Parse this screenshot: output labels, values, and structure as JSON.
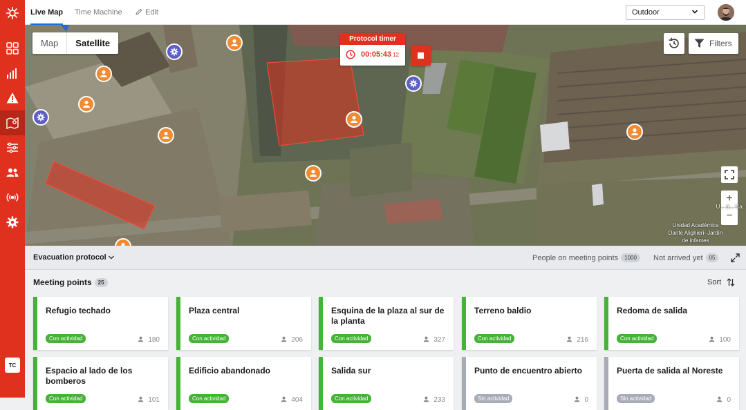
{
  "sidebar": {
    "items": [
      {
        "icon": "grid-icon"
      },
      {
        "icon": "bar-chart-icon"
      },
      {
        "icon": "alert-icon"
      },
      {
        "icon": "map-icon",
        "active": true
      },
      {
        "icon": "sliders-icon"
      },
      {
        "icon": "users-icon"
      },
      {
        "icon": "broadcast-icon"
      },
      {
        "icon": "gear-icon"
      }
    ],
    "user_initials": "TC"
  },
  "topbar": {
    "tabs": [
      {
        "label": "Live Map",
        "active": true
      },
      {
        "label": "Time Machine"
      },
      {
        "label": "Edit"
      }
    ],
    "mode_select": "Outdoor"
  },
  "map": {
    "toggle": {
      "map": "Map",
      "satellite": "Satellite",
      "selected": "Satellite"
    },
    "protocol_timer": {
      "title": "Protocol timer",
      "time": "00:05:43",
      "fraction": "12"
    },
    "filters_label": "Filters",
    "labels": [
      "Unidad Académica Dante Alighieri- Jardín de infantes",
      "U... d... Ca..."
    ]
  },
  "evacuation": {
    "title": "Evacuation protocol",
    "people_on_meeting_points_label": "People on meeting points",
    "people_on_meeting_points": "1000",
    "not_arrived_label": "Not arrived yet",
    "not_arrived": "05"
  },
  "meeting_points": {
    "title": "Meeting points",
    "count": "25",
    "sort_label": "Sort",
    "cards": [
      {
        "name": "Refugio techado",
        "status": "Con actividad",
        "people": "180"
      },
      {
        "name": "Plaza central",
        "status": "Con actividad",
        "people": "206"
      },
      {
        "name": "Esquina de la plaza al sur de la planta",
        "status": "Con actividad",
        "people": "327"
      },
      {
        "name": "Terreno baldio",
        "status": "Con actividad",
        "people": "216"
      },
      {
        "name": "Redoma de salida",
        "status": "Con actividad",
        "people": "100"
      },
      {
        "name": "Espacio al lado de los bomberos",
        "status": "Con actividad",
        "people": "101"
      },
      {
        "name": "Edificio abandonado",
        "status": "Con actividad",
        "people": "404"
      },
      {
        "name": "Salida sur",
        "status": "Con actividad",
        "people": "233"
      },
      {
        "name": "Punto de encuentro abierto",
        "status": "Sin actividad",
        "people": "0"
      },
      {
        "name": "Puerta de salida al Noreste",
        "status": "Sin actividad",
        "people": "0"
      }
    ]
  },
  "colors": {
    "brand": "#e0301e",
    "active_green": "#44b336",
    "inactive_gray": "#a7adb6",
    "person_pin": "#f08a33",
    "device_pin": "#5b5fc7"
  }
}
